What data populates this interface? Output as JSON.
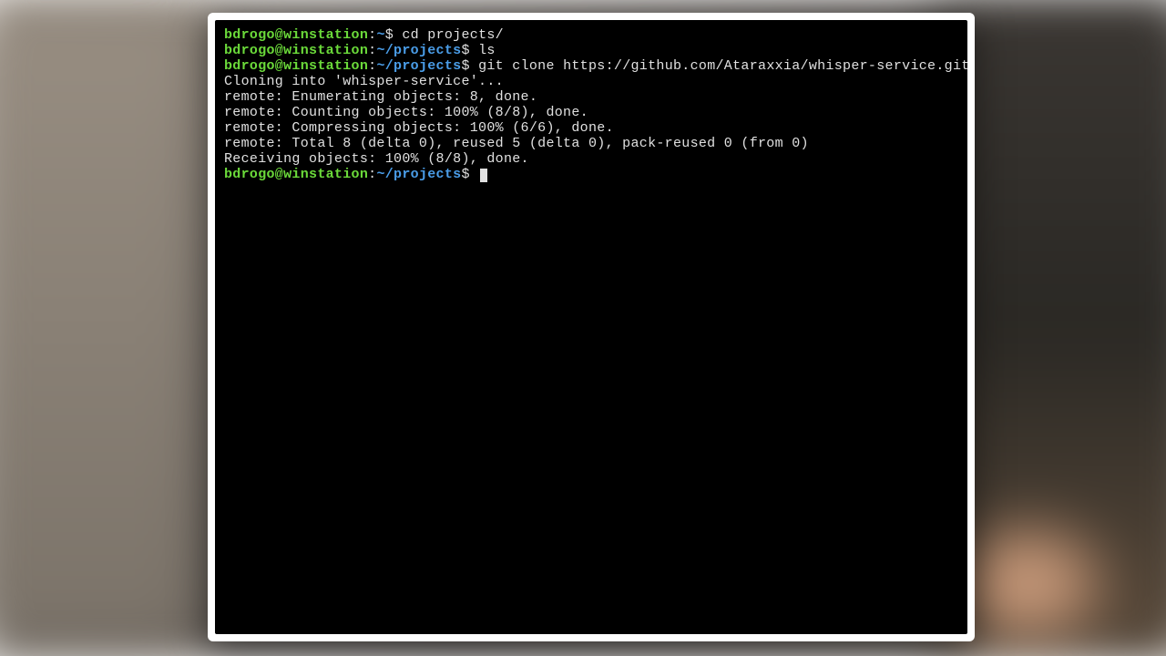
{
  "terminal": {
    "lines": [
      {
        "type": "prompt",
        "user": "bdrogo@winstation",
        "sep": ":",
        "path": "~",
        "dollar": "$",
        "cmd": " cd projects/"
      },
      {
        "type": "prompt",
        "user": "bdrogo@winstation",
        "sep": ":",
        "path": "~/projects",
        "dollar": "$",
        "cmd": " ls"
      },
      {
        "type": "prompt",
        "user": "bdrogo@winstation",
        "sep": ":",
        "path": "~/projects",
        "dollar": "$",
        "cmd": " git clone https://github.com/Ataraxxia/whisper-service.git"
      },
      {
        "type": "output",
        "text": "Cloning into 'whisper-service'..."
      },
      {
        "type": "output",
        "text": "remote: Enumerating objects: 8, done."
      },
      {
        "type": "output",
        "text": "remote: Counting objects: 100% (8/8), done."
      },
      {
        "type": "output",
        "text": "remote: Compressing objects: 100% (6/6), done."
      },
      {
        "type": "output",
        "text": "remote: Total 8 (delta 0), reused 5 (delta 0), pack-reused 0 (from 0)"
      },
      {
        "type": "output",
        "text": "Receiving objects: 100% (8/8), done."
      },
      {
        "type": "prompt",
        "user": "bdrogo@winstation",
        "sep": ":",
        "path": "~/projects",
        "dollar": "$",
        "cmd": " ",
        "cursor": true
      }
    ]
  }
}
